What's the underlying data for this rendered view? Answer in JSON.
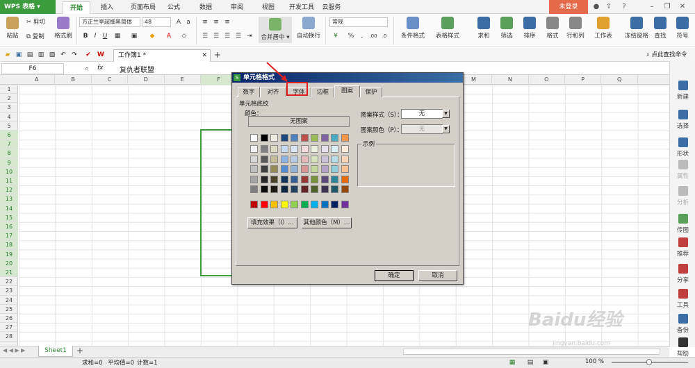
{
  "app": {
    "title": "WPS 表格",
    "login": "未登录"
  },
  "tabs": [
    "开始",
    "插入",
    "页面布局",
    "公式",
    "数据",
    "审阅",
    "视图",
    "开发工具",
    "云服务"
  ],
  "ribbon": {
    "paste": "粘贴",
    "cut": "剪切",
    "copy": "复制",
    "format_painter": "格式刷",
    "font_name": "方正兰亭超细黑简体",
    "font_size": "48",
    "merge": "合并居中",
    "wrap": "自动换行",
    "number_format": "常规",
    "conditional": "条件格式",
    "table_style": "表格样式",
    "sum": "求和",
    "filter": "筛选",
    "sort": "排序",
    "format": "格式",
    "rowcol": "行和列",
    "sheet": "工作表",
    "freeze": "冻结窗格",
    "find": "查找",
    "symbol": "符号"
  },
  "qat": {
    "doc_tab": "工作簿1 *",
    "search": "点此查找命令"
  },
  "formula": {
    "cell_ref": "F6",
    "fx": "fx",
    "content": "复仇者联盟"
  },
  "columns": [
    "A",
    "B",
    "C",
    "D",
    "E",
    "F",
    "G",
    "H",
    "I",
    "J",
    "K",
    "L",
    "M",
    "N",
    "O",
    "P",
    "Q"
  ],
  "rows": [
    "1",
    "2",
    "3",
    "4",
    "5",
    "6",
    "7",
    "8",
    "9",
    "10",
    "11",
    "12",
    "13",
    "14",
    "15",
    "16",
    "17",
    "18",
    "19",
    "20",
    "21",
    "22",
    "23",
    "24",
    "25",
    "26",
    "27",
    "28"
  ],
  "sidebar": [
    "新建",
    "选择",
    "形状",
    "属性",
    "分析",
    "传图",
    "推荐",
    "分享",
    "工具",
    "备份",
    "帮助"
  ],
  "dialog": {
    "title": "单元格格式",
    "tabs": [
      "数字",
      "对齐",
      "字体",
      "边框",
      "图案",
      "保护"
    ],
    "group": "单元格底纹",
    "color_label": "颜色：",
    "no_pattern": "无图案",
    "pattern_style_label": "图案样式（S）：",
    "pattern_style_value": "无",
    "pattern_color_label": "图案颜色（P）：",
    "pattern_color_value": "无",
    "sample_label": "示例",
    "fill_effects": "填充效果（I）…",
    "more_colors": "其他颜色（M）…",
    "ok": "确定",
    "cancel": "取消"
  },
  "palette": [
    [
      "#ffffff",
      "#000000",
      "#eeece1",
      "#1f497d",
      "#4f81bd",
      "#c0504d",
      "#9bbb59",
      "#8064a2",
      "#4bacc6",
      "#f79646"
    ],
    [
      "#f2f2f2",
      "#7f7f7f",
      "#ddd9c3",
      "#c6d9f0",
      "#dbe5f1",
      "#f2dcdb",
      "#ebf1dd",
      "#e5e0ec",
      "#dbeef3",
      "#fdeada"
    ],
    [
      "#d8d8d8",
      "#595959",
      "#c4bd97",
      "#8db3e2",
      "#b8cce4",
      "#e5b9b7",
      "#d7e3bc",
      "#ccc1d9",
      "#b7dde8",
      "#fbd5b5"
    ],
    [
      "#bfbfbf",
      "#3f3f3f",
      "#938953",
      "#548dd4",
      "#95b3d7",
      "#d99694",
      "#c3d69b",
      "#b2a2c7",
      "#92cddc",
      "#fac08f"
    ],
    [
      "#a5a5a5",
      "#262626",
      "#494429",
      "#17365d",
      "#366092",
      "#953734",
      "#76923c",
      "#5f497a",
      "#31859b",
      "#e36c09"
    ],
    [
      "#7f7f7f",
      "#0c0c0c",
      "#1d1b10",
      "#0f243e",
      "#244061",
      "#632423",
      "#4f6128",
      "#3f3151",
      "#205867",
      "#974806"
    ],
    [
      "#c00000",
      "#ff0000",
      "#ffc000",
      "#ffff00",
      "#92d050",
      "#00b050",
      "#00b0f0",
      "#0070c0",
      "#002060",
      "#7030a0"
    ]
  ],
  "sheet": {
    "name": "Sheet1",
    "add": "+"
  },
  "status": {
    "sum": "求和=0",
    "avg": "平均值=0",
    "count": "计数=1",
    "zoom": "100 %"
  },
  "watermark": {
    "brand": "Baidu经验",
    "url": "jingyan.baidu.com"
  }
}
